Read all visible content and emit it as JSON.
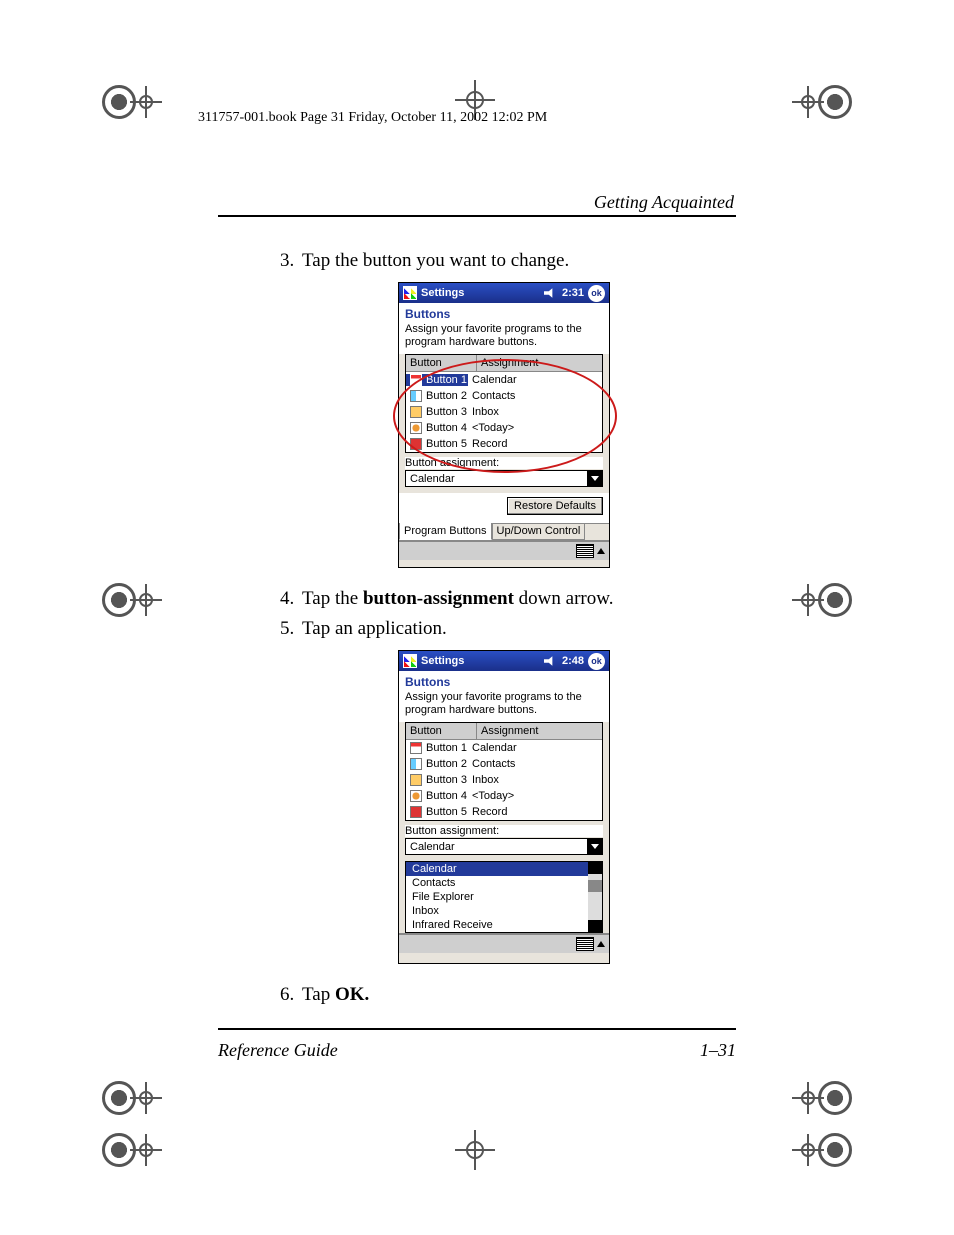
{
  "meta": {
    "header": "311757-001.book  Page 31  Friday, October 11, 2002  12:02 PM",
    "section": "Getting Acquainted",
    "footer_left": "Reference Guide",
    "footer_right": "1–31"
  },
  "steps": {
    "s3": "Tap the button you want to change.",
    "s4_pre": "Tap the ",
    "s4_bold": "button-assignment",
    "s4_post": " down arrow.",
    "s5": "Tap an application.",
    "s6_pre": "Tap ",
    "s6_bold": "OK."
  },
  "shot1": {
    "title": "Settings",
    "time": "2:31",
    "ok": "ok",
    "panel_title": "Buttons",
    "panel_sub": "Assign your favorite programs to the program hardware buttons.",
    "col_button": "Button",
    "col_assign": "Assignment",
    "rows": [
      {
        "name": "Button 1",
        "assign": "Calendar"
      },
      {
        "name": "Button 2",
        "assign": "Contacts"
      },
      {
        "name": "Button 3",
        "assign": "Inbox"
      },
      {
        "name": "Button 4",
        "assign": "<Today>"
      },
      {
        "name": "Button 5",
        "assign": "Record"
      }
    ],
    "assign_label": "Button assignment:",
    "assign_value": "Calendar",
    "restore": "Restore Defaults",
    "tab1": "Program Buttons",
    "tab2": "Up/Down Control"
  },
  "shot2": {
    "title": "Settings",
    "time": "2:48",
    "ok": "ok",
    "panel_title": "Buttons",
    "panel_sub": "Assign your favorite programs to the program hardware buttons.",
    "col_button": "Button",
    "col_assign": "Assignment",
    "rows": [
      {
        "name": "Button 1",
        "assign": "Calendar"
      },
      {
        "name": "Button 2",
        "assign": "Contacts"
      },
      {
        "name": "Button 3",
        "assign": "Inbox"
      },
      {
        "name": "Button 4",
        "assign": "<Today>"
      },
      {
        "name": "Button 5",
        "assign": "Record"
      }
    ],
    "assign_label": "Button assignment:",
    "assign_value": "Calendar",
    "dropdown": [
      "Calendar",
      "Contacts",
      "File Explorer",
      "Inbox",
      "Infrared Receive"
    ]
  }
}
